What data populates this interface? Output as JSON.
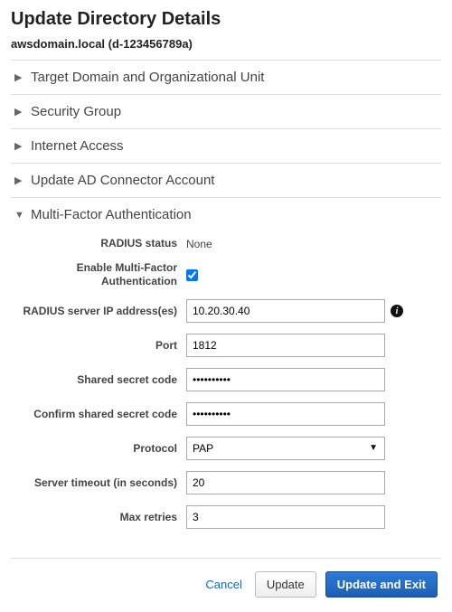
{
  "page": {
    "title": "Update Directory Details",
    "subtitle": "awsdomain.local (d-123456789a)"
  },
  "sections": {
    "target": {
      "label": "Target Domain and Organizational Unit",
      "expanded": false
    },
    "security": {
      "label": "Security Group",
      "expanded": false
    },
    "internet": {
      "label": "Internet Access",
      "expanded": false
    },
    "connector": {
      "label": "Update AD Connector Account",
      "expanded": false
    },
    "mfa": {
      "label": "Multi-Factor Authentication",
      "expanded": true
    }
  },
  "mfa": {
    "radius_status_label": "RADIUS status",
    "radius_status_value": "None",
    "enable_label": "Enable Multi-Factor Authentication",
    "enable_checked": true,
    "server_ip_label": "RADIUS server IP address(es)",
    "server_ip_value": "10.20.30.40",
    "port_label": "Port",
    "port_value": "1812",
    "secret_label": "Shared secret code",
    "secret_value": "••••••••••",
    "confirm_label": "Confirm shared secret code",
    "confirm_value": "••••••••••",
    "protocol_label": "Protocol",
    "protocol_value": "PAP",
    "timeout_label": "Server timeout (in seconds)",
    "timeout_value": "20",
    "retries_label": "Max retries",
    "retries_value": "3"
  },
  "footer": {
    "cancel": "Cancel",
    "update": "Update",
    "update_exit": "Update and Exit"
  }
}
